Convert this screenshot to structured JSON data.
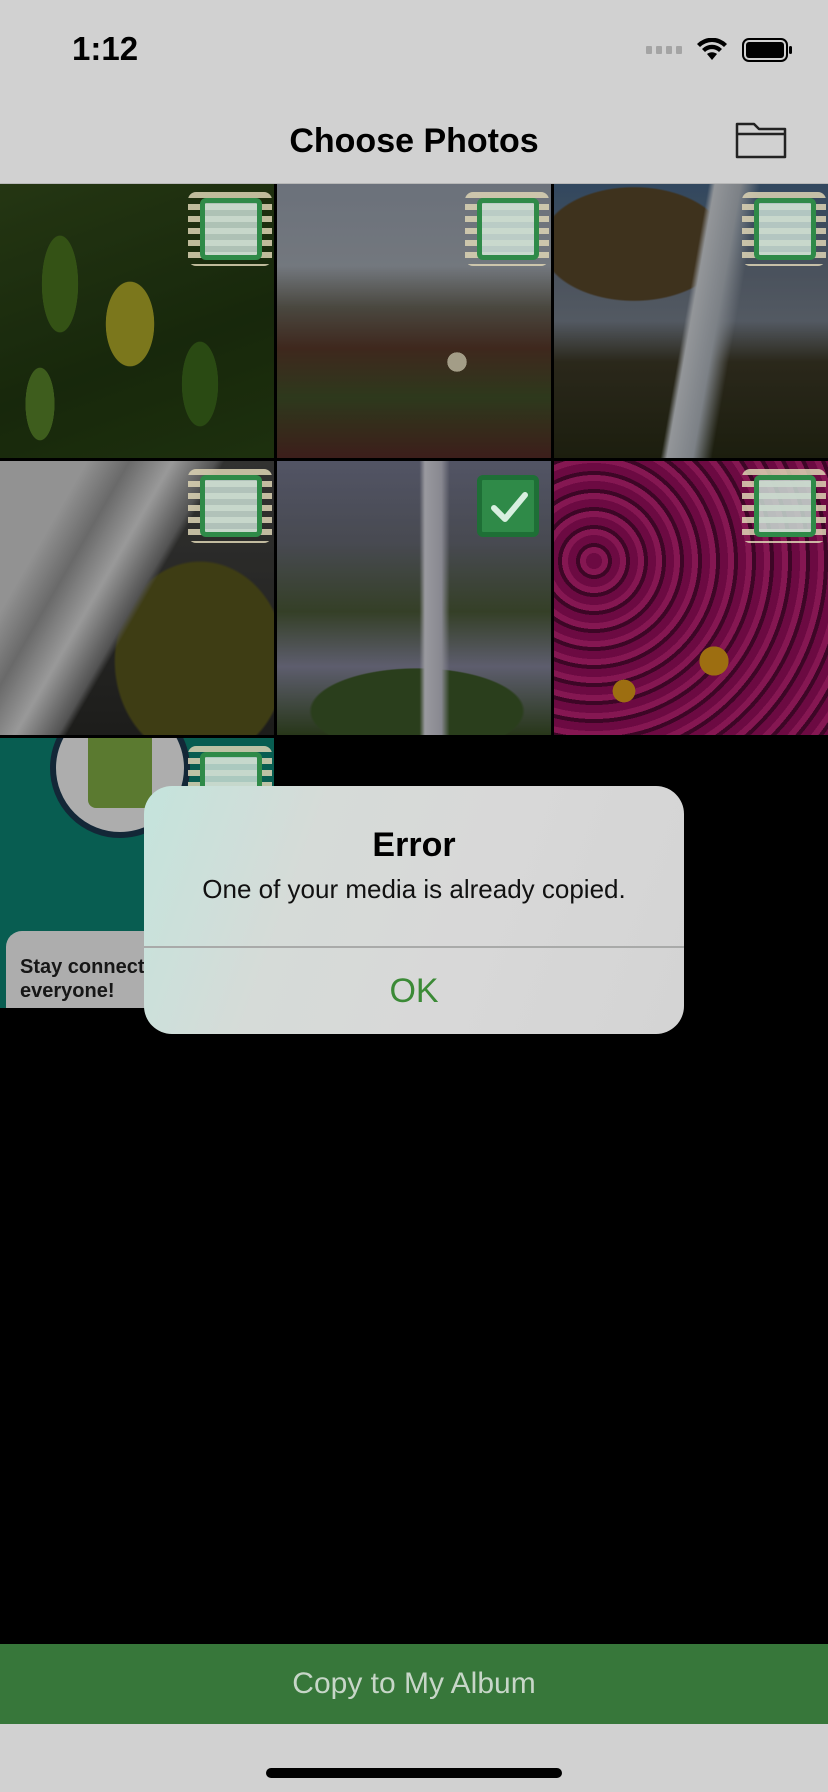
{
  "status_bar": {
    "time": "1:12"
  },
  "nav": {
    "title": "Choose Photos",
    "right_icon": "folder-icon"
  },
  "photos": [
    {
      "name": "green-leaves",
      "checked": false
    },
    {
      "name": "dune-flower",
      "checked": false
    },
    {
      "name": "waterfall-cliff",
      "checked": false
    },
    {
      "name": "waterfall-mossy-rock",
      "checked": false
    },
    {
      "name": "misty-waterfall",
      "checked": true
    },
    {
      "name": "pink-flowers",
      "checked": false
    },
    {
      "name": "shopify-promo",
      "checked": false
    }
  ],
  "promo_card": {
    "line1": "Stay connected",
    "line2": "everyone!"
  },
  "alert": {
    "title": "Error",
    "message": "One of your media is already copied.",
    "ok_label": "OK"
  },
  "bottom": {
    "copy_label": "Copy to My Album"
  },
  "colors": {
    "accent_green": "#37773a",
    "check_green": "#2f8a48",
    "ok_green": "#3b8a36"
  }
}
